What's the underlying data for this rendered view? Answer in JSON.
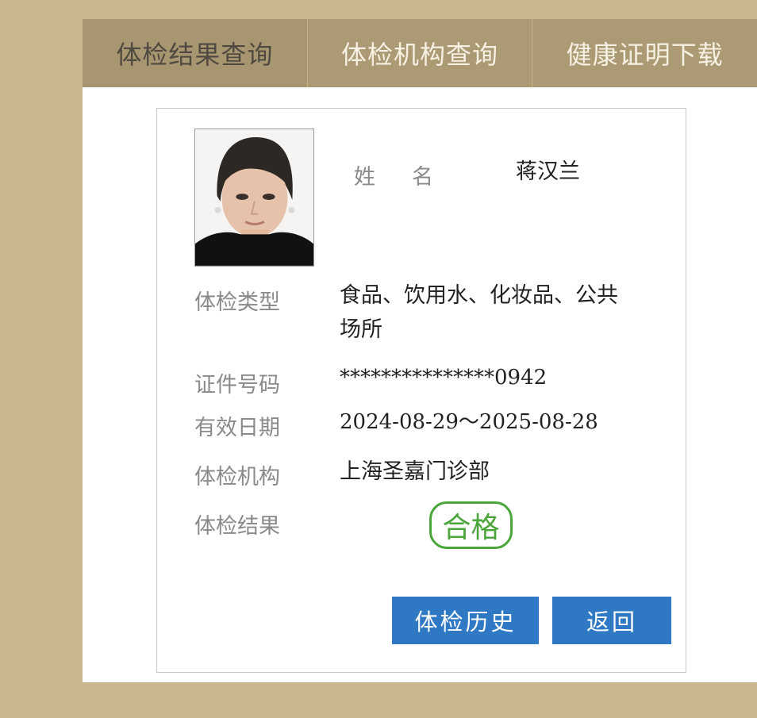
{
  "tabs": [
    {
      "label": "体检结果查询",
      "active": true
    },
    {
      "label": "体检机构查询",
      "active": false
    },
    {
      "label": "健康证明下载",
      "active": false
    }
  ],
  "profile": {
    "name_label": "姓名",
    "name": "蒋汉兰"
  },
  "details": {
    "exam_type_label": "体检类型",
    "exam_type": "食品、饮用水、化妆品、公共场所",
    "id_label": "证件号码",
    "id_number": "***************0942",
    "validity_label": "有效日期",
    "validity": "2024-08-29～2025-08-28",
    "institution_label": "体检机构",
    "institution": "上海圣嘉门诊部",
    "result_label": "体检结果",
    "result_stamp": "合格"
  },
  "buttons": {
    "history": "体检历史",
    "back": "返回"
  },
  "colors": {
    "background": "#c9b68e",
    "tab_bar": "#ab9a73",
    "stamp_green": "#4aa53a",
    "button_blue": "#2f78c4"
  }
}
